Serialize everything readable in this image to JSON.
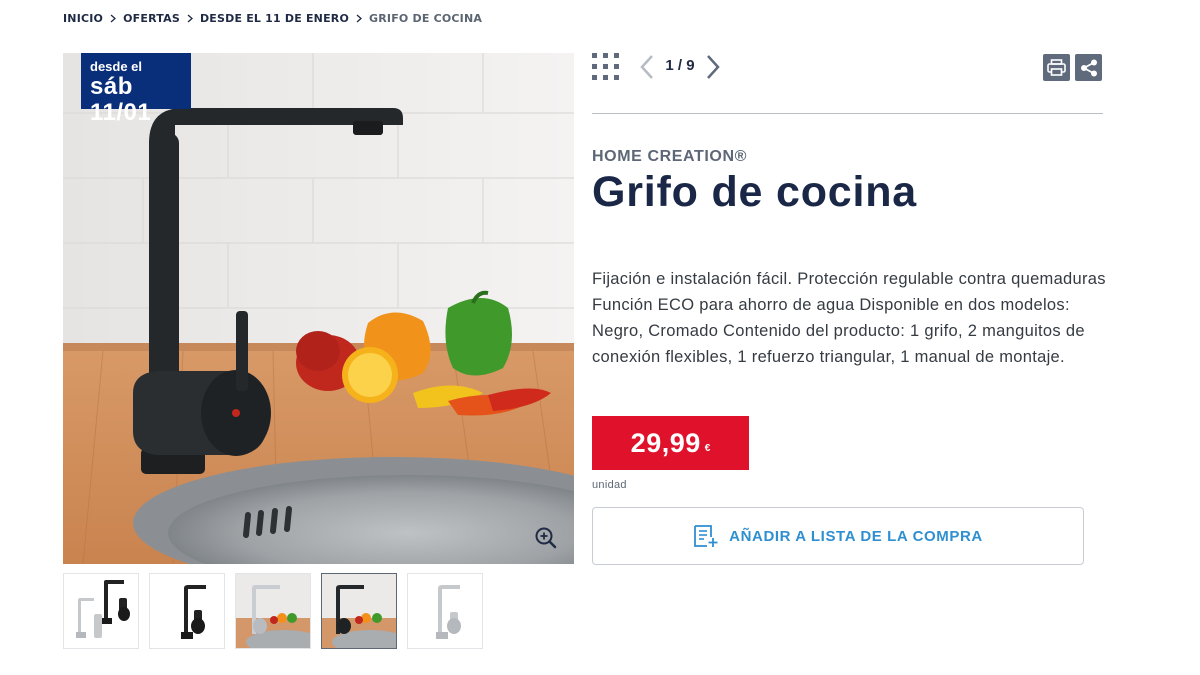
{
  "breadcrumb": {
    "items": [
      {
        "label": "INICIO"
      },
      {
        "label": "OFERTAS"
      },
      {
        "label": "DESDE EL 11 DE ENERO"
      },
      {
        "label": "GRIFO DE COCINA"
      }
    ]
  },
  "gallery": {
    "badge": {
      "line1": "desde el",
      "line2": "sáb 11/01"
    },
    "counter": "1 / 9",
    "grid_icon": "grid-icon",
    "prev_icon": "chevron-left-icon",
    "next_icon": "chevron-right-icon",
    "zoom_icon": "zoom-in-icon",
    "thumbnails": [
      {
        "name": "thumb-black-chrome-pair",
        "active": false
      },
      {
        "name": "thumb-black-faucet",
        "active": false
      },
      {
        "name": "thumb-chrome-kitchen",
        "active": false
      },
      {
        "name": "thumb-black-kitchen",
        "active": true
      },
      {
        "name": "thumb-chrome-faucet",
        "active": false
      }
    ]
  },
  "toolbar": {
    "print_icon": "print-icon",
    "share_icon": "share-icon"
  },
  "product": {
    "brand": "HOME CREATION®",
    "title": "Grifo de cocina",
    "description": "Fijación e instalación fácil. Protección regulable contra quemaduras Función ECO para ahorro de agua Disponible en dos modelos: Negro, Cromado Contenido del producto: 1 grifo, 2 manguitos de conexión flexibles, 1 refuerzo triangular, 1 manual de montaje.",
    "price": "29,99",
    "currency": "€",
    "unit": "unidad",
    "add_to_list_label": "AÑADIR A LISTA DE LA COMPRA"
  },
  "colors": {
    "accent_blue": "#2f8fd0",
    "navy": "#1a2746",
    "badge_blue": "#0a2f7a",
    "price_red": "#e0112b"
  }
}
